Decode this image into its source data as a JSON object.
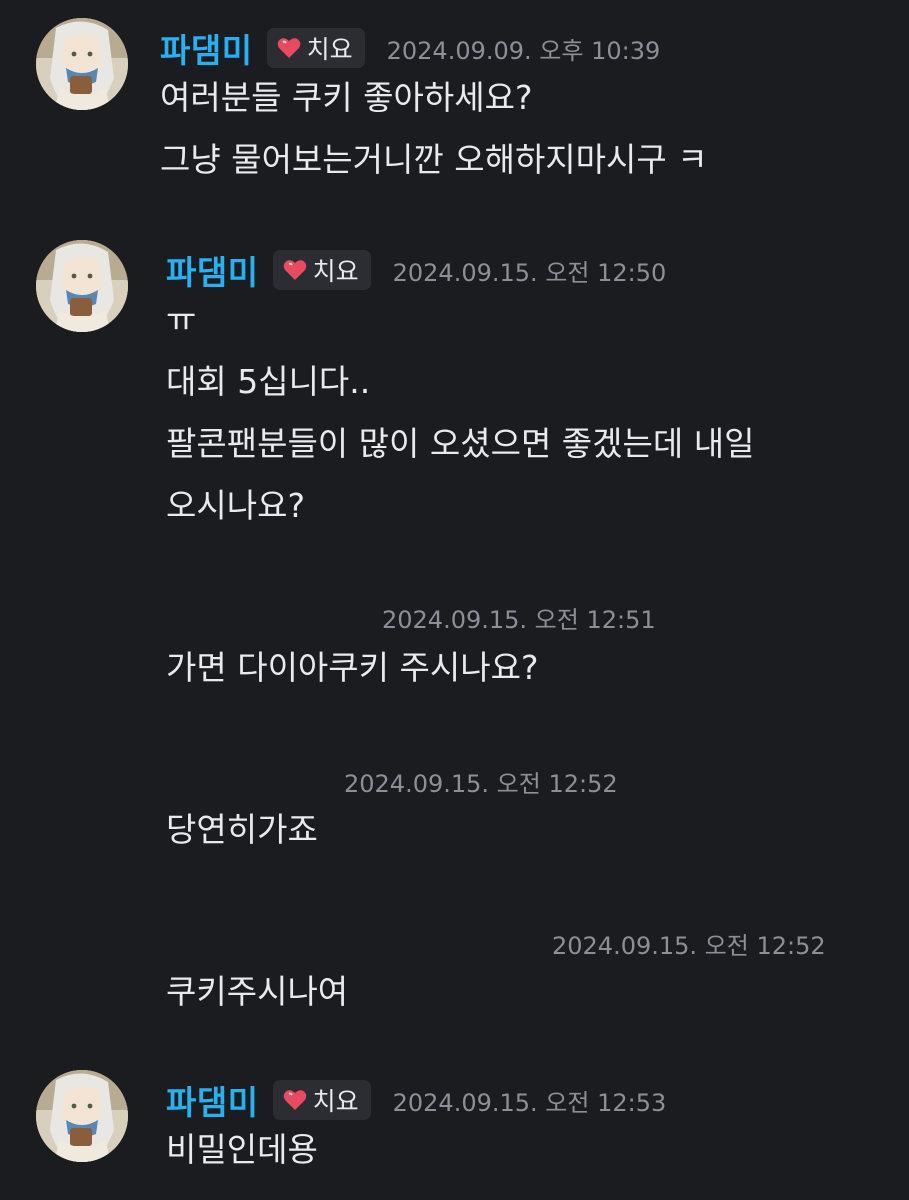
{
  "colors": {
    "background": "#1b1c20",
    "username": "#27b1f2",
    "timestamp": "#8d8f98",
    "badge_bg": "#2c2d33",
    "text": "#e9eaee",
    "heart": "#e84a5f"
  },
  "badge_icon": "pixel-heart-icon",
  "messages": [
    {
      "username": "파댐미",
      "badge": "치요",
      "timestamp": "2024.09.09. 오후 10:39",
      "lines": [
        "여러분들 쿠키 좋아하세요?",
        "그냥 물어보는거니깐 오해하지마시구 ㅋ"
      ]
    },
    {
      "username": "파댐미",
      "badge": "치요",
      "timestamp": "2024.09.15. 오전 12:50",
      "lines": [
        "ㅠ",
        "대회 5십니다..",
        "팔콘팬분들이 많이 오셨으면 좋겠는데 내일",
        "오시나요?"
      ]
    },
    {
      "timestamp": "2024.09.15. 오전 12:51",
      "lines": [
        "가면 다이아쿠키 주시나요?"
      ]
    },
    {
      "timestamp": "2024.09.15. 오전 12:52",
      "lines": [
        "당연히가죠"
      ]
    },
    {
      "timestamp": "2024.09.15. 오전 12:52",
      "lines": [
        "쿠키주시나여"
      ]
    },
    {
      "username": "파댐미",
      "badge": "치요",
      "timestamp": "2024.09.15. 오전 12:53",
      "lines": [
        "비밀인데용"
      ]
    }
  ]
}
